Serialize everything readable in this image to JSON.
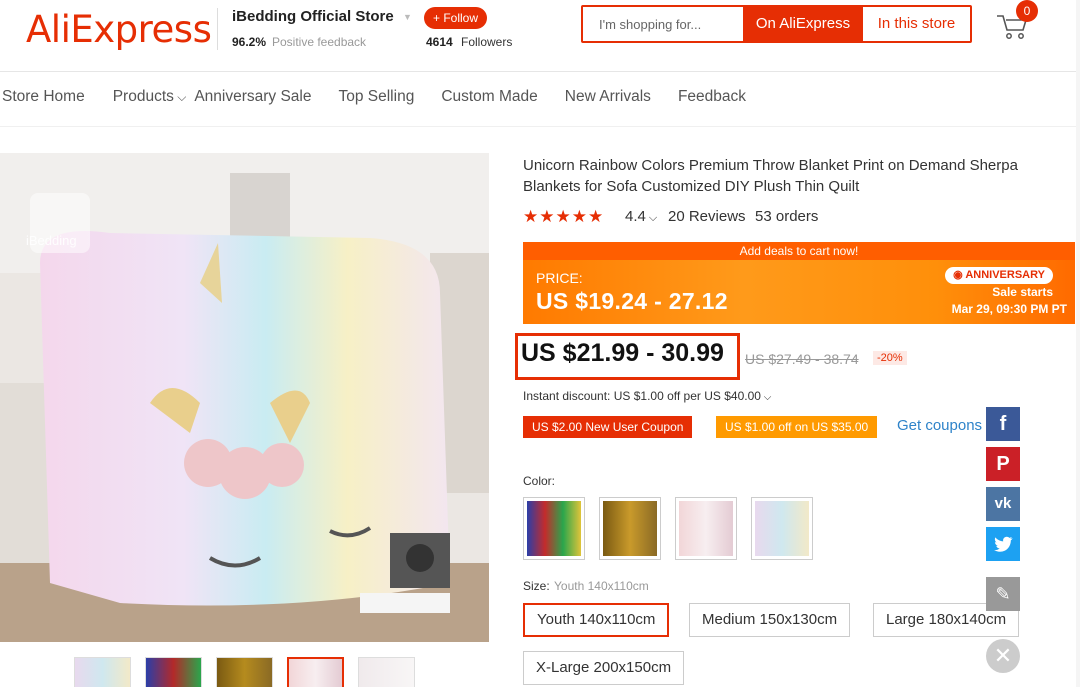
{
  "header": {
    "logo": "AliExpress",
    "store_name": "iBedding Official Store",
    "follow_label": "+ Follow",
    "feedback_percent": "96.2%",
    "feedback_label": "Positive feedback",
    "followers_count": "4614",
    "followers_label": "Followers",
    "search_placeholder": "I'm shopping for...",
    "search_on_aliexpress": "On AliExpress",
    "search_in_store": "In this store",
    "cart_count": "0",
    "accent_color": "#e62e04"
  },
  "nav": {
    "items": [
      "Store Home",
      "Products",
      "Anniversary Sale",
      "Top Selling",
      "Custom Made",
      "New Arrivals",
      "Feedback"
    ]
  },
  "product": {
    "title": "Unicorn Rainbow Colors Premium Throw Blanket Print on Demand Sherpa Blankets for Sofa Customized DIY Plush Thin Quilt",
    "rating": "4.4",
    "reviews": "20 Reviews",
    "orders": "53 orders",
    "promo": {
      "banner": "Add deals to cart now!",
      "price_label": "PRICE:",
      "price": "US $19.24 - 27.12",
      "badge": "ANNIVERSARY",
      "sale_starts": "Sale starts",
      "sale_date": "Mar 29, 09:30 PM PT"
    },
    "price": "US $21.99 - 30.99",
    "original_price": "US $27.49 - 38.74",
    "discount": "-20%",
    "instant_discount": "Instant discount: US $1.00 off per US $40.00",
    "coupons": [
      "US $2.00 New User Coupon",
      "US $1.00 off on US $35.00"
    ],
    "get_coupons": "Get coupons",
    "color_label": "Color:",
    "size_label": "Size:",
    "size_selected": "Youth 140x110cm",
    "sizes": [
      "Youth 140x110cm",
      "Medium 150x130cm",
      "Large 180x140cm",
      "X-Large 200x150cm"
    ],
    "image_watermark": "iBedding"
  },
  "share": {
    "facebook": "f",
    "pinterest": "P",
    "vk": "vk",
    "twitter": "t"
  }
}
